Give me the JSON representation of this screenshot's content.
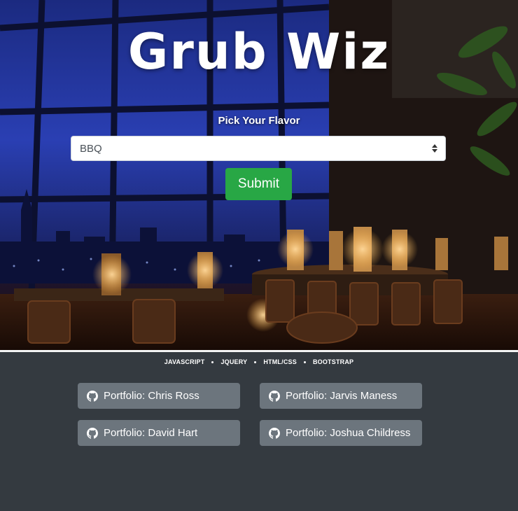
{
  "hero": {
    "title": "Grub Wiz",
    "flavor_label": "Pick Your Flavor",
    "flavor_select": {
      "selected": "BBQ"
    },
    "submit_label": "Submit"
  },
  "footer": {
    "technologies": [
      "JAVASCRIPT",
      "JQUERY",
      "HTML/CSS",
      "BOOTSTRAP"
    ],
    "portfolio_links": [
      {
        "label": "Portfolio: Chris Ross",
        "icon": "github-icon"
      },
      {
        "label": "Portfolio: Jarvis Maness",
        "icon": "github-icon"
      },
      {
        "label": "Portfolio: David Hart",
        "icon": "github-icon"
      },
      {
        "label": "Portfolio: Joshua Childress",
        "icon": "github-icon"
      }
    ]
  },
  "colors": {
    "submit": "#28a745",
    "portfolio_button": "#6c757d",
    "footer_background": "#343a40"
  }
}
